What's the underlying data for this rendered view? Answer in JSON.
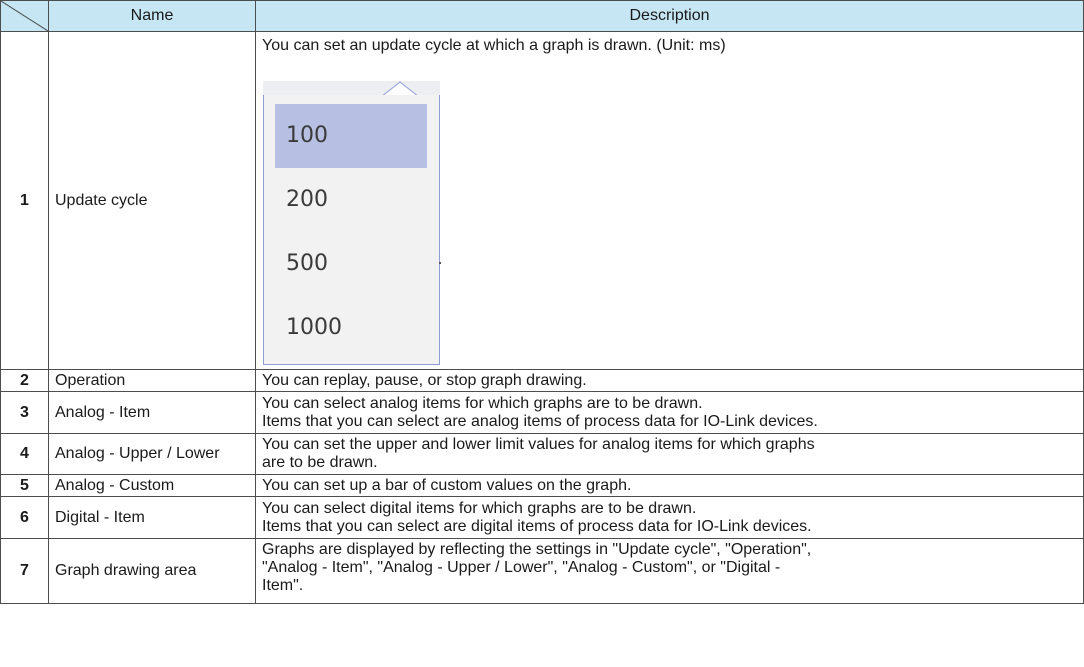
{
  "header": {
    "name": "Name",
    "description": "Description"
  },
  "rows": [
    {
      "num": "1",
      "name": "Update cycle",
      "desc_lines": [
        "You can set an update cycle at which a graph is drawn. (Unit: ms)"
      ]
    },
    {
      "num": "2",
      "name": "Operation",
      "desc_lines": [
        "You can replay, pause, or stop graph drawing."
      ]
    },
    {
      "num": "3",
      "name": "Analog - Item",
      "desc_lines": [
        "You can select analog items for which graphs are to be drawn.",
        "Items that you can select are analog items of process data for IO-Link devices."
      ]
    },
    {
      "num": "4",
      "name": "Analog - Upper / Lower",
      "desc_lines": [
        "You can set the upper and lower limit values for analog items for which graphs",
        "are to be drawn."
      ]
    },
    {
      "num": "5",
      "name": "Analog - Custom",
      "desc_lines": [
        "You can set up a bar of custom values on the graph."
      ]
    },
    {
      "num": "6",
      "name": "Digital - Item",
      "desc_lines": [
        "You can select digital items for which graphs are to be drawn.",
        "Items that you can select are digital items of process data for IO-Link devices."
      ]
    },
    {
      "num": "7",
      "name": "Graph drawing area",
      "desc_lines": [
        "Graphs are displayed by reflecting the settings in \"Update cycle\", \"Operation\",",
        "\"Analog - Item\", \"Analog - Upper / Lower\", \"Analog - Custom\", or \"Digital -",
        "Item\"."
      ]
    }
  ],
  "dropdown": {
    "options": [
      "100",
      "200",
      "500",
      "1000"
    ],
    "selected": "100",
    "colors": {
      "selected_bg": "#b7bfe3",
      "border": "#8f9ed2",
      "bg": "#f2f2f2"
    }
  },
  "colors": {
    "header_bg": "#c6e6f4",
    "grid": "#4d4d4d"
  }
}
